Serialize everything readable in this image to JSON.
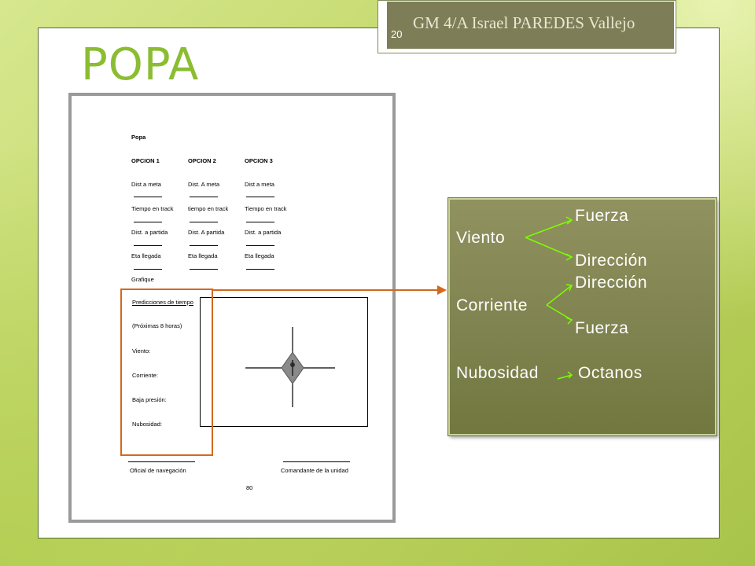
{
  "slide": {
    "title": "POPA",
    "page_number": "20",
    "author": "GM 4/A Israel PAREDES Vallejo"
  },
  "document": {
    "heading": "Popa",
    "options": [
      "OPCION 1",
      "OPCION 2",
      "OPCION 3"
    ],
    "row1": [
      "Dist a meta",
      "Dist. A meta",
      "Dist a meta"
    ],
    "row2": [
      "Tiempo en track",
      "tiempo en track",
      "Tiempo en track"
    ],
    "row3": [
      "Dist. a partida",
      "Dist. A partida",
      "Dist. a partida"
    ],
    "row4": [
      "Eta llegada",
      "Eta llegada",
      "Eta llegada"
    ],
    "grafique": "Grafique",
    "predictions": [
      "Predicciones  de tiempo",
      "(Próximas 8 horas)",
      "Viento:",
      "Corriente:",
      "Baja presión:",
      "Nubosidad:"
    ],
    "signature_left": "Oficial de navegación",
    "signature_right": "Comandante  de la unidad",
    "page": "80"
  },
  "info_box": {
    "viento": "Viento",
    "viento_fuerza": "Fuerza",
    "viento_direccion": "Dirección",
    "corriente": "Corriente",
    "corriente_direccion": "Dirección",
    "corriente_fuerza": "Fuerza",
    "nubosidad": "Nubosidad",
    "octanos": "Octanos"
  },
  "colors": {
    "title": "#8bbd32",
    "highlight": "#d2691e",
    "box": "#7f8350",
    "arrow": "#7cfc00"
  }
}
